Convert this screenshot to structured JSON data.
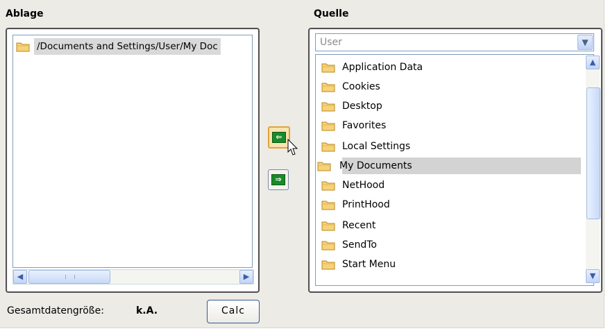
{
  "ablage": {
    "title": "Ablage",
    "items": [
      {
        "label": "/Documents and Settings/User/My Doc"
      }
    ]
  },
  "quelle": {
    "title": "Quelle",
    "dropdown_value": "User",
    "items": [
      {
        "label": "Application Data"
      },
      {
        "label": "Cookies"
      },
      {
        "label": "Desktop"
      },
      {
        "label": "Favorites"
      },
      {
        "label": "Local Settings"
      },
      {
        "label": "My Documents",
        "selected": true
      },
      {
        "label": "NetHood"
      },
      {
        "label": "PrintHood"
      },
      {
        "label": "Recent"
      },
      {
        "label": "SendTo"
      },
      {
        "label": "Start Menu"
      }
    ]
  },
  "footer": {
    "size_label": "Gesamtdatengröße:",
    "size_value": "k.A.",
    "calc_button": "Calc"
  },
  "icons": {
    "move_left": "arrow-left-icon",
    "move_right": "arrow-right-icon",
    "folder": "folder-icon"
  },
  "colors": {
    "selection": "#d3d3d3",
    "move_button": "#1a8a2a",
    "active_button_border": "#e0a43a"
  }
}
